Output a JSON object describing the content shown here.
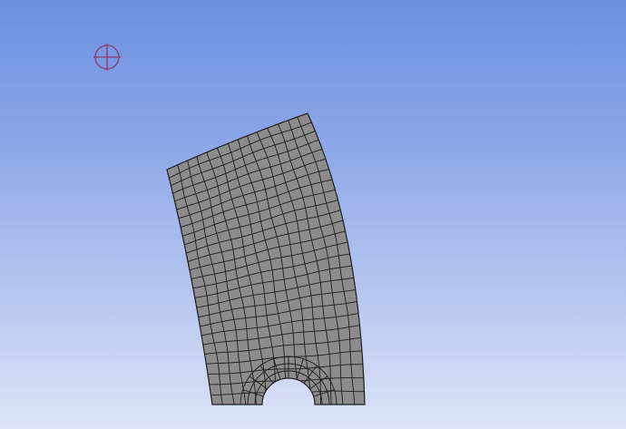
{
  "viewport": {
    "background_top": "#6b8fe0",
    "background_bottom": "#dde4f8"
  },
  "origin_marker": {
    "icon": "crosshair-circle-icon",
    "color": "#8e3a6e"
  },
  "mesh": {
    "face_color": "#8c8c8c",
    "edge_color": "#1e1e1e",
    "radial_divisions": 14,
    "arc_divisions": 26,
    "has_hole": true
  }
}
